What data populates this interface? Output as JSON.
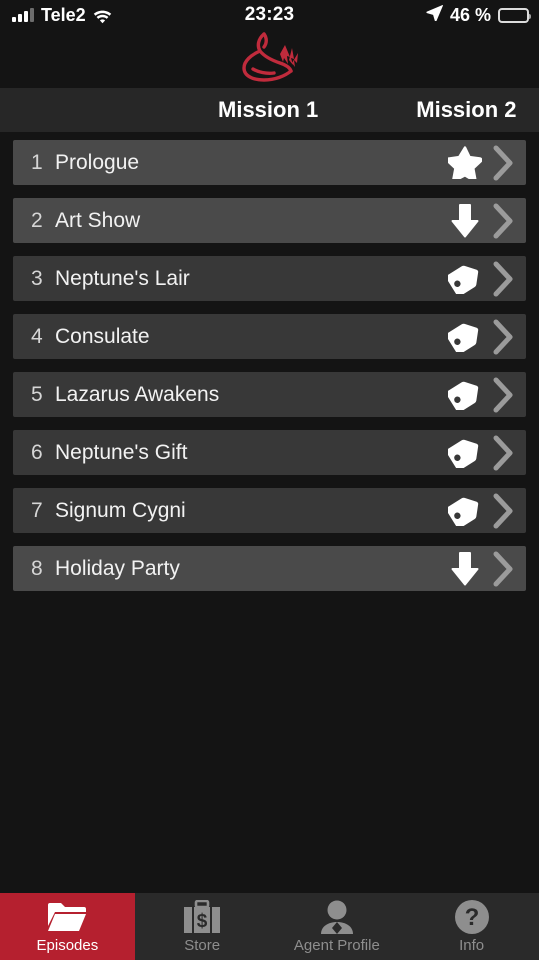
{
  "status_bar": {
    "carrier": "Tele2",
    "time": "23:23",
    "battery_percent_label": "46 %",
    "battery_level": 46,
    "signal_bars_filled": 3,
    "signal_bars_total": 4,
    "wifi_icon": "wifi-icon",
    "location_icon": "location-arrow-icon",
    "battery_icon": "battery-icon"
  },
  "app_header": {
    "logo_icon": "swan-logo-icon",
    "logo_color": "#c02b3c"
  },
  "mission_tabs": {
    "items": [
      {
        "label": "Mission 1",
        "selected": true
      },
      {
        "label": "Mission 2",
        "selected": false
      }
    ]
  },
  "episodes": {
    "rows": [
      {
        "number": "1",
        "title": "Prologue",
        "status_icon": "star-icon",
        "chevron_icon": "chevron-right-icon",
        "highlighted": true
      },
      {
        "number": "2",
        "title": "Art Show",
        "status_icon": "download-icon",
        "chevron_icon": "chevron-right-icon",
        "highlighted": true
      },
      {
        "number": "3",
        "title": "Neptune's Lair",
        "status_icon": "tag-icon",
        "chevron_icon": "chevron-right-icon",
        "highlighted": false
      },
      {
        "number": "4",
        "title": "Consulate",
        "status_icon": "tag-icon",
        "chevron_icon": "chevron-right-icon",
        "highlighted": false
      },
      {
        "number": "5",
        "title": "Lazarus Awakens",
        "status_icon": "tag-icon",
        "chevron_icon": "chevron-right-icon",
        "highlighted": false
      },
      {
        "number": "6",
        "title": "Neptune's Gift",
        "status_icon": "tag-icon",
        "chevron_icon": "chevron-right-icon",
        "highlighted": false
      },
      {
        "number": "7",
        "title": "Signum Cygni",
        "status_icon": "tag-icon",
        "chevron_icon": "chevron-right-icon",
        "highlighted": false
      },
      {
        "number": "8",
        "title": "Holiday Party",
        "status_icon": "download-icon",
        "chevron_icon": "chevron-right-icon",
        "highlighted": true
      }
    ]
  },
  "tab_bar": {
    "active_color": "#b5202f",
    "items": [
      {
        "label": "Episodes",
        "icon": "folder-icon",
        "active": true
      },
      {
        "label": "Store",
        "icon": "briefcase-dollar-icon",
        "active": false
      },
      {
        "label": "Agent Profile",
        "icon": "person-icon",
        "active": false
      },
      {
        "label": "Info",
        "icon": "question-circle-icon",
        "active": false
      }
    ]
  }
}
